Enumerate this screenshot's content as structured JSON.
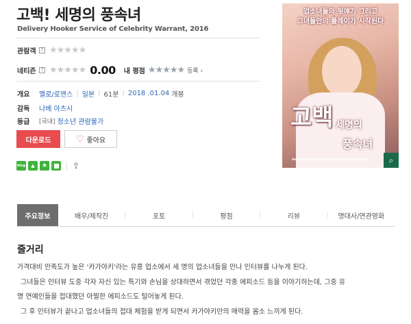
{
  "movie": {
    "title": "고백! 세명의 풍속녀",
    "subtitle": "Delivery Hooker Service of Celebrity Warrant, 2016"
  },
  "ratings": {
    "audience_label": "관람객",
    "audience_stars": "★★★★★",
    "netizen_label": "네티즌",
    "netizen_stars": "★★★★★",
    "netizen_score": "0.00",
    "my_rating_label": "내 평점",
    "my_stars": "★★★★★",
    "register_label": "등록 ›",
    "help_mark": "?"
  },
  "info": {
    "overview_label": "개요",
    "genre": "멜로/로맨스",
    "country": "일본",
    "runtime": "61분",
    "release_date": "2018 .01.04",
    "release_suffix": "개봉",
    "director_label": "감독",
    "director": "나베 아츠시",
    "grade_label": "등급",
    "grade_region": "[국내]",
    "grade": "청소년 관람불가"
  },
  "buttons": {
    "download": "다운로드",
    "like": "좋아요"
  },
  "share": {
    "blog": "blog",
    "icons": [
      "blog-share-icon",
      "cafe-share-icon",
      "bookmark-star-icon",
      "me2-share-icon",
      "share-icon"
    ]
  },
  "poster": {
    "tagline_line1": "업소녀들의 뒷얘기 그리고",
    "tagline_line2": "그녀들만의 플레이가 시작된다",
    "title_big": "고백",
    "title_small_1": "세명의",
    "title_small_2": "풍속녀"
  },
  "tabs": [
    {
      "label": "주요정보"
    },
    {
      "label": "배우/제작진"
    },
    {
      "label": "포토"
    },
    {
      "label": "평점"
    },
    {
      "label": "리뷰"
    },
    {
      "label": "명대사/연관영화"
    }
  ],
  "synopsis": {
    "title": "줄거리",
    "lines": [
      "가격대비 만족도가 높은 '카가야키'라는 유흥 업소에서 세 명의 업소녀들을 만나 인터뷰를 나누게 된다.",
      "그녀들은 인터뷰 도중 각자 자신 있는 특기와 손님을 상대하면서 겪었던 각종 에피소드 등을 이야기하는데, 그중 유",
      "명 연예인들을 접대했던 아찔한 에피소드도 털어놓게 된다.",
      "그 후 인터뷰가 끝나고 업소녀들의 접대 체험을 받게 되면서 카가야키만의 매력을 몸소 느끼게 된다."
    ]
  },
  "colors": {
    "accent_red": "#e84c4f",
    "link_blue": "#2a64b8",
    "active_tab": "#6d6d6d",
    "share_green": "#3fb43c"
  }
}
